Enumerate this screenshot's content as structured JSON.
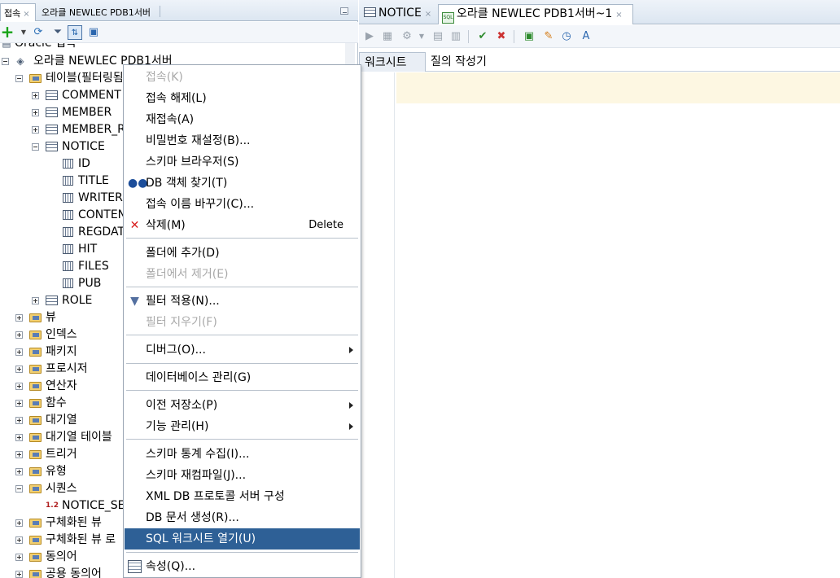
{
  "left_tabs": [
    {
      "label": "접속",
      "close": "×"
    },
    {
      "label": "오라클 NEWLEC PDB1서버"
    }
  ],
  "tree": {
    "partial_top": "Oracle 접속",
    "connection": "오라클 NEWLEC PDB1서버",
    "tables_node": "테이블(필터링됨)",
    "tables": [
      "COMMENT",
      "MEMBER",
      "MEMBER_R"
    ],
    "notice_table": "NOTICE",
    "notice_columns": [
      "ID",
      "TITLE",
      "WRITER",
      "CONTEN",
      "REGDAT",
      "HIT",
      "FILES",
      "PUB"
    ],
    "role_table": "ROLE",
    "groups_a": [
      "뷰",
      "인덱스",
      "패키지",
      "프로시저",
      "연산자",
      "함수",
      "대기열",
      "대기열 테이블",
      "트리거",
      "유형"
    ],
    "sequences_node": "시퀀스",
    "sequence_child": "NOTICE_SE",
    "groups_b": [
      "구체화된 뷰",
      "구체화된 뷰 로",
      "동의어",
      "공용 동의어"
    ]
  },
  "editor_tabs": [
    {
      "label": "NOTICE",
      "close": "×"
    },
    {
      "label": "오라클 NEWLEC PDB1서버~1",
      "close": "×"
    }
  ],
  "sub_tabs": [
    "워크시트",
    "질의 작성기"
  ],
  "menu": {
    "items": [
      {
        "label": "접속(K)",
        "enabled": false
      },
      {
        "label": "접속 해제(L)",
        "enabled": true
      },
      {
        "label": "재접속(A)",
        "enabled": true
      },
      {
        "label": "비밀번호 재설정(B)...",
        "enabled": true
      },
      {
        "label": "스키마 브라우저(S)",
        "enabled": true
      },
      {
        "label": "DB 객체 찾기(T)",
        "enabled": true,
        "icon": "binoculars-icon"
      },
      {
        "label": "접속 이름 바꾸기(C)...",
        "enabled": true
      },
      {
        "label": "삭제(M)",
        "enabled": true,
        "icon": "delete-x-icon",
        "shortcut": "Delete"
      },
      {
        "label": "폴더에 추가(D)",
        "enabled": true
      },
      {
        "label": "폴더에서 제거(E)",
        "enabled": false
      },
      {
        "label": "필터 적용(N)...",
        "enabled": true,
        "icon": "filter-icon"
      },
      {
        "label": "필터 지우기(F)",
        "enabled": false
      },
      {
        "label": "디버그(O)...",
        "enabled": true,
        "submenu": true
      },
      {
        "label": "데이터베이스 관리(G)",
        "enabled": true
      },
      {
        "label": "이전 저장소(P)",
        "enabled": true,
        "submenu": true
      },
      {
        "label": "기능 관리(H)",
        "enabled": true,
        "submenu": true
      },
      {
        "label": "스키마 통계 수집(I)...",
        "enabled": true
      },
      {
        "label": "스키마 재컴파일(J)...",
        "enabled": true
      },
      {
        "label": "XML DB 프로토콜 서버 구성",
        "enabled": true
      },
      {
        "label": "DB 문서 생성(R)...",
        "enabled": true
      },
      {
        "label": "SQL 워크시트 열기(U)",
        "enabled": true,
        "highlighted": true
      },
      {
        "label": "속성(Q)...",
        "enabled": true,
        "icon": "properties-icon"
      }
    ]
  },
  "colors": {
    "menu_highlight": "#2e6096",
    "current_line": "#fdf7e2",
    "disabled_text": "#a9a9a9"
  }
}
